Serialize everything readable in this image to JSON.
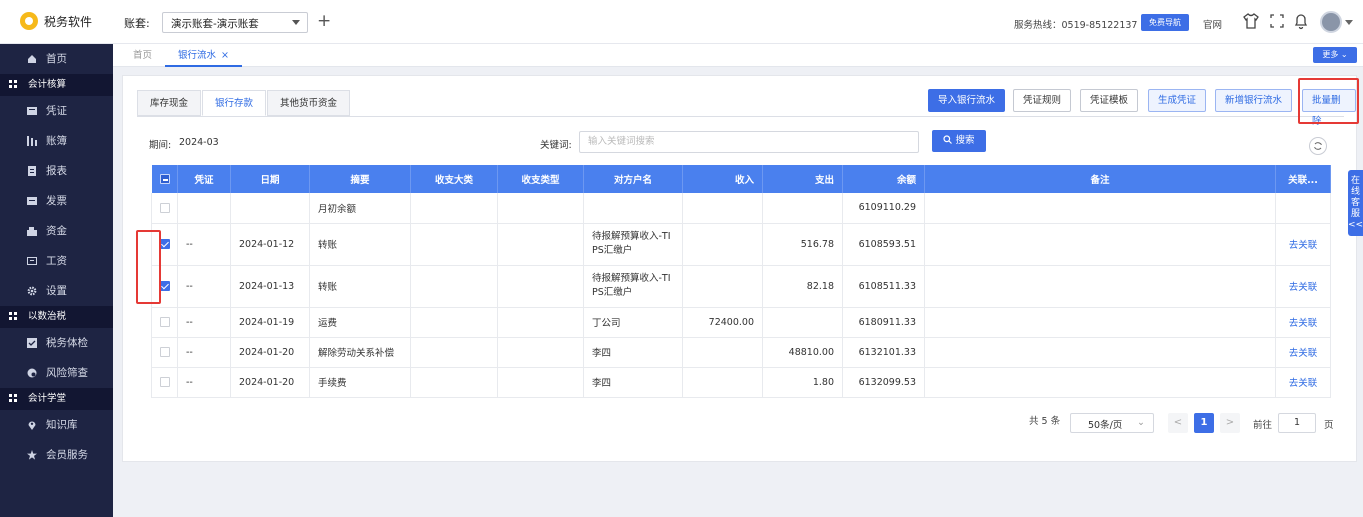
{
  "app": {
    "name": "税务软件"
  },
  "topbar": {
    "account_label": "账套:",
    "account_value": "演示账套-演示账套",
    "hotline": "服务热线：0519-85122137",
    "guide_button": "免费导航",
    "homepage": "官网"
  },
  "sidebar": {
    "items": [
      {
        "label": "首页",
        "icon": "home-icon"
      },
      {
        "label": "会计核算",
        "icon": "grid-icon",
        "group": true
      },
      {
        "label": "凭证",
        "icon": "voucher-icon"
      },
      {
        "label": "账簿",
        "icon": "ledger-icon"
      },
      {
        "label": "报表",
        "icon": "report-icon"
      },
      {
        "label": "发票",
        "icon": "invoice-icon"
      },
      {
        "label": "资金",
        "icon": "fund-icon"
      },
      {
        "label": "工资",
        "icon": "salary-icon"
      },
      {
        "label": "设置",
        "icon": "settings-icon"
      },
      {
        "label": "以数治税",
        "icon": "grid-icon",
        "group": true
      },
      {
        "label": "税务体检",
        "icon": "check-icon"
      },
      {
        "label": "风险筛查",
        "icon": "risk-icon"
      },
      {
        "label": "会计学堂",
        "icon": "grid-icon",
        "group": true
      },
      {
        "label": "知识库",
        "icon": "pin-icon"
      },
      {
        "label": "会员服务",
        "icon": "star-icon"
      }
    ]
  },
  "page_tabs": [
    {
      "label": "首页",
      "active": false
    },
    {
      "label": "银行流水",
      "active": true,
      "close": "×"
    }
  ],
  "more_button": "更多 ⌄",
  "sub_tabs": [
    "库存现金",
    "银行存款",
    "其他货币资金"
  ],
  "actions": {
    "import": "导入银行流水",
    "voucher_rule": "凭证规则",
    "voucher_template": "凭证模板",
    "generate_voucher": "生成凭证",
    "add_flow": "新增银行流水",
    "batch_delete": "批量删除"
  },
  "filters": {
    "period_label": "期间:",
    "period_value": "2024-03",
    "keyword_label": "关键词:",
    "keyword_placeholder": "输入关键词搜索",
    "search_button": "搜索"
  },
  "table": {
    "columns": [
      "凭证",
      "日期",
      "摘要",
      "收支大类",
      "收支类型",
      "对方户名",
      "收入",
      "支出",
      "余额",
      "备注",
      "关联..."
    ],
    "rows": [
      {
        "checked": false,
        "voucher": "",
        "date": "",
        "summary": "月初余额",
        "major": "",
        "type": "",
        "party": "",
        "income": "",
        "expense": "",
        "balance": "6109110.29",
        "note": "",
        "link": ""
      },
      {
        "checked": true,
        "voucher": "--",
        "date": "2024-01-12",
        "summary": "转账",
        "major": "",
        "type": "",
        "party": "待报解预算收入-TIPS汇缴户",
        "income": "",
        "expense": "516.78",
        "balance": "6108593.51",
        "note": "",
        "link": "去关联"
      },
      {
        "checked": true,
        "voucher": "--",
        "date": "2024-01-13",
        "summary": "转账",
        "major": "",
        "type": "",
        "party": "待报解预算收入-TIPS汇缴户",
        "income": "",
        "expense": "82.18",
        "balance": "6108511.33",
        "note": "",
        "link": "去关联"
      },
      {
        "checked": false,
        "voucher": "--",
        "date": "2024-01-19",
        "summary": "运费",
        "major": "",
        "type": "",
        "party": "丁公司",
        "income": "72400.00",
        "expense": "",
        "balance": "6180911.33",
        "note": "",
        "link": "去关联"
      },
      {
        "checked": false,
        "voucher": "--",
        "date": "2024-01-20",
        "summary": "解除劳动关系补偿",
        "major": "",
        "type": "",
        "party": "李四",
        "income": "",
        "expense": "48810.00",
        "balance": "6132101.33",
        "note": "",
        "link": "去关联"
      },
      {
        "checked": false,
        "voucher": "--",
        "date": "2024-01-20",
        "summary": "手续费",
        "major": "",
        "type": "",
        "party": "李四",
        "income": "",
        "expense": "1.80",
        "balance": "6132099.53",
        "note": "",
        "link": "去关联"
      }
    ]
  },
  "pagination": {
    "total": "共 5 条",
    "page_size": "50条/页",
    "prev": "<",
    "current": "1",
    "next": ">",
    "goto_label": "前往",
    "goto_value": "1",
    "page_suffix": "页"
  },
  "service_float": "在线客服<<",
  "colors": {
    "primary": "#3d6ee6",
    "sidebar": "#1e2443",
    "highlight": "#e53935"
  }
}
